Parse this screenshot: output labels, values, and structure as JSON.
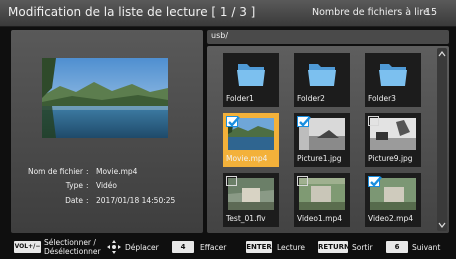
{
  "header": {
    "title": "Modification de la liste de lecture [ 1 / 3 ]",
    "file_count_label": "Nombre de fichiers à lire",
    "file_count": "15"
  },
  "details": {
    "filename_label": "Nom de fichier",
    "filename": "Movie.mp4",
    "type_label": "Type",
    "type": "Vidéo",
    "date_label": "Date",
    "date": "2017/01/18  14:50:25"
  },
  "path": "usb/",
  "items": [
    {
      "label": "Folder1",
      "kind": "folder-icon",
      "checked": false
    },
    {
      "label": "Folder2",
      "kind": "folder-icon",
      "checked": false
    },
    {
      "label": "Folder3",
      "kind": "folder-icon",
      "checked": false
    },
    {
      "label": "Movie.mp4",
      "kind": "video-thumbnail",
      "checked": true,
      "selected": true
    },
    {
      "label": "Picture1.jpg",
      "kind": "photo-thumbnail",
      "checked": true
    },
    {
      "label": "Picture9.jpg",
      "kind": "photo-thumbnail",
      "checked": false
    },
    {
      "label": "Test_01.flv",
      "kind": "video-thumbnail",
      "checked": false
    },
    {
      "label": "Video1.mp4",
      "kind": "video-thumbnail",
      "checked": false
    },
    {
      "label": "Video2.mp4",
      "kind": "video-thumbnail",
      "checked": true
    }
  ],
  "footer": {
    "vol_key": "VOL+/−",
    "vol_label_1": "Sélectionner /",
    "vol_label_2": "Désélectionner",
    "nav_label": "Déplacer",
    "key_4": "4",
    "key_4_label": "Effacer",
    "enter_key": "ENTER",
    "enter_label": "Lecture",
    "return_key": "RETURN",
    "return_label": "Sortir",
    "key_6": "6",
    "key_6_label": "Suivant"
  },
  "colors": {
    "selected": "#f3b13a",
    "check": "#1a8fe0",
    "folder": "#6fb4e8"
  }
}
